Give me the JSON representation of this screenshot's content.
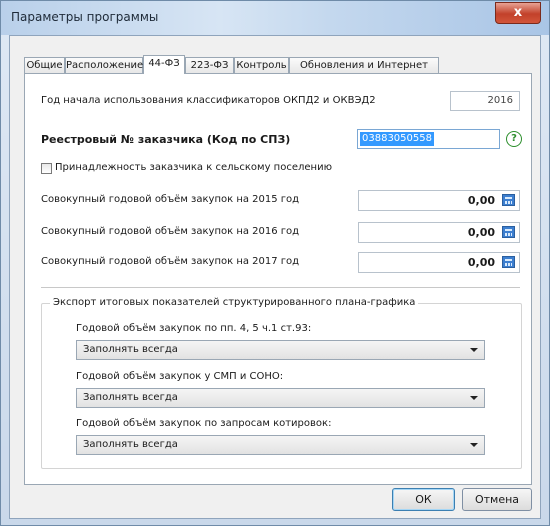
{
  "window": {
    "title": "Параметры программы",
    "close_glyph": "x"
  },
  "tabs": [
    {
      "label": "Общие"
    },
    {
      "label": "Расположение"
    },
    {
      "label": "44-ФЗ"
    },
    {
      "label": "223-ФЗ"
    },
    {
      "label": "Контроль"
    },
    {
      "label": "Обновления и Интернет"
    }
  ],
  "active_tab": "44-ФЗ",
  "fz44": {
    "classifier_year_label": "Год начала использования классификаторов ОКПД2 и ОКВЭД2",
    "classifier_year_value": "2016",
    "registry_label": "Реестровый № заказчика (Код по СПЗ)",
    "registry_value": "03883050558",
    "help_glyph": "?",
    "rural_checkbox_label": "Принадлежность заказчика к сельскому поселению",
    "rural_checked": false,
    "volumes": [
      {
        "label": "Совокупный годовой объём закупок на 2015 год",
        "value": "0,00"
      },
      {
        "label": "Совокупный годовой объём закупок на 2016 год",
        "value": "0,00"
      },
      {
        "label": "Совокупный годовой объём закупок на 2017 год",
        "value": "0,00"
      }
    ],
    "export_group": {
      "title": "Экспорт итоговых показателей структурированного плана-графика",
      "fields": [
        {
          "label": "Годовой объём закупок по пп. 4, 5 ч.1 ст.93:",
          "selected": "Заполнять всегда"
        },
        {
          "label": "Годовой объём закупок у СМП и СОНО:",
          "selected": "Заполнять всегда"
        },
        {
          "label": "Годовой объём закупок по запросам котировок:",
          "selected": "Заполнять всегда"
        }
      ]
    }
  },
  "buttons": {
    "ok": "ОК",
    "cancel": "Отмена"
  },
  "colors": {
    "selection": "#3399ff",
    "help_green": "#2d8f2d",
    "calc_blue": "#3d7fd0"
  }
}
